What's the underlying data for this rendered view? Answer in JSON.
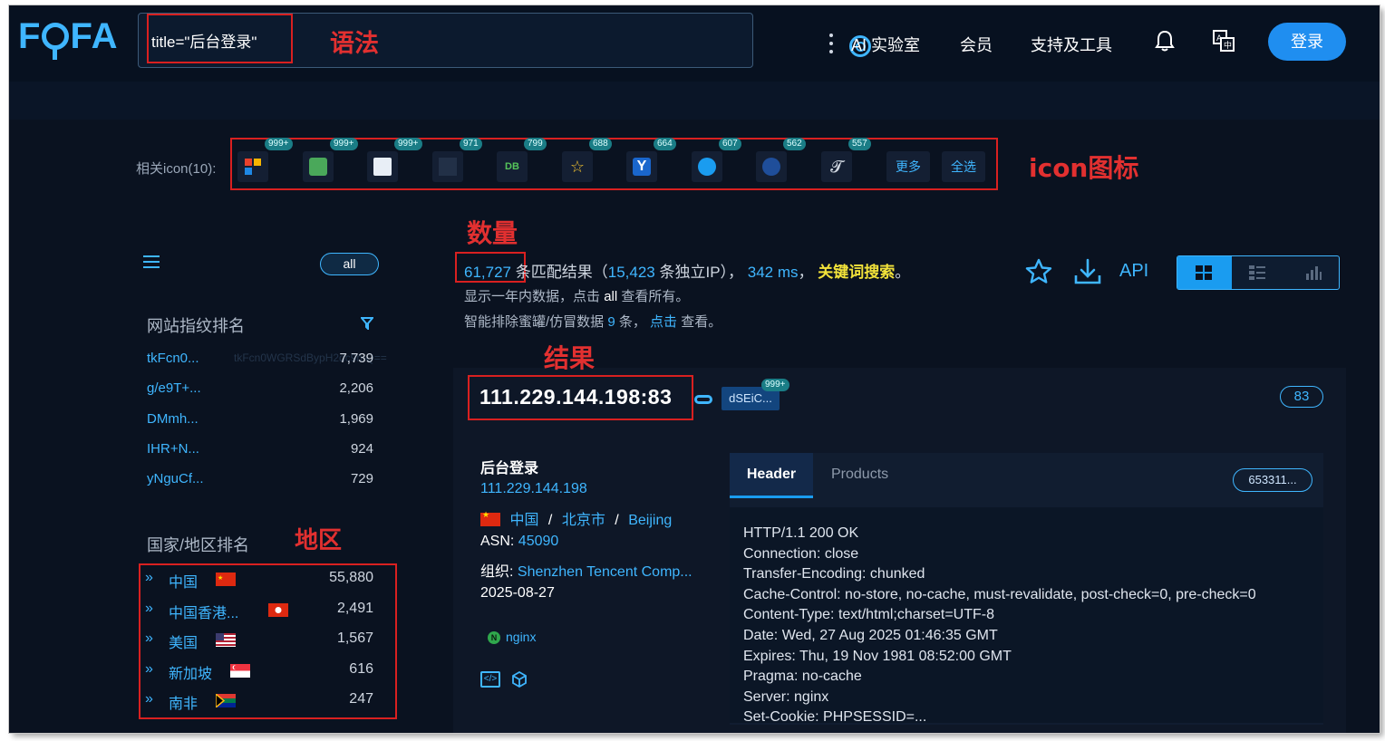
{
  "header": {
    "logo_text": "FOFA",
    "search_value": "title=\"后台登录\"",
    "nav": [
      "AI 实验室",
      "会员",
      "支持及工具"
    ],
    "login_label": "登录"
  },
  "icons": {
    "label": "相关icon(10):",
    "items": [
      {
        "badge": "999+",
        "glyph": "",
        "name": "windows-logo-icon"
      },
      {
        "badge": "999+",
        "glyph": "",
        "name": "green-leaf-icon"
      },
      {
        "badge": "999+",
        "glyph": "",
        "name": "document-icon"
      },
      {
        "badge": "971",
        "glyph": "",
        "name": "dark-app-icon"
      },
      {
        "badge": "799",
        "glyph": "DB",
        "name": "db-icon"
      },
      {
        "badge": "688",
        "glyph": "☆",
        "name": "star-app-icon"
      },
      {
        "badge": "664",
        "glyph": "Y",
        "name": "yellow-app-icon"
      },
      {
        "badge": "607",
        "glyph": "",
        "name": "chat-bubble-icon"
      },
      {
        "badge": "562",
        "glyph": "",
        "name": "globe-icon"
      },
      {
        "badge": "557",
        "glyph": "𝓣",
        "name": "script-t-icon"
      }
    ],
    "more_label": "更多",
    "select_all_label": "全选"
  },
  "annotations": {
    "syntax": "语法",
    "icon": "icon图标",
    "count": "数量",
    "result": "结果",
    "region": "地区"
  },
  "sidebar": {
    "all_label": "all",
    "fingerprint_title": "网站指纹排名",
    "fingerprints": [
      {
        "name": "tkFcn0...",
        "count": "7,739"
      },
      {
        "name": "g/e9T+...",
        "count": "2,206"
      },
      {
        "name": "DMmh...",
        "count": "1,969"
      },
      {
        "name": "IHR+N...",
        "count": "924"
      },
      {
        "name": "yNguCf...",
        "count": "729"
      }
    ],
    "fingerprint_ghost": "tkFcn0WGRSdBypH2dc9nIQ==",
    "country_title": "国家/地区排名",
    "countries": [
      {
        "name": "中国",
        "count": "55,880",
        "flag": "cn"
      },
      {
        "name": "中国香港...",
        "count": "2,491",
        "flag": "hk"
      },
      {
        "name": "美国",
        "count": "1,567",
        "flag": "us"
      },
      {
        "name": "新加坡",
        "count": "616",
        "flag": "sg"
      },
      {
        "name": "南非",
        "count": "247",
        "flag": "za"
      }
    ]
  },
  "stats": {
    "total": "61,727",
    "text_match": "条匹配结果（",
    "unique_ip": "15,423",
    "text_ip": "条独立IP），",
    "time": "342 ms",
    "text_comma": "，",
    "keyword": "关键词搜索",
    "text_end": "。",
    "line2_a": "显示一年内数据，点击",
    "line2_all": "all",
    "line2_b": "查看所有。",
    "line3_a": "智能排除蜜罐/仿冒数据",
    "line3_num": "9",
    "line3_b": "条，",
    "line3_click": "点击",
    "line3_c": "查看。",
    "api_label": "API"
  },
  "result": {
    "host": "111.229.144.198:83",
    "cert_chip": "dSEiC...",
    "cert_badge": "999+",
    "port": "83",
    "title": "后台登录",
    "ip": "111.229.144.198",
    "country": "中国",
    "sep": "/",
    "city": "北京市",
    "city_en": "Beijing",
    "asn_label": "ASN:",
    "asn": "45090",
    "org_label": "组织:",
    "org": "Shenzhen Tencent Comp...",
    "date": "2025-08-27",
    "server_tag": "nginx",
    "tab_header": "Header",
    "tab_products": "Products",
    "hash": "653311...",
    "header_lines": [
      "HTTP/1.1 200 OK",
      "Connection: close",
      "Transfer-Encoding: chunked",
      "Cache-Control: no-store, no-cache, must-revalidate, post-check=0, pre-check=0",
      "Content-Type: text/html;charset=UTF-8",
      "Date: Wed, 27 Aug 2025 01:46:35 GMT",
      "Expires: Thu, 19 Nov 1981 08:52:00 GMT",
      "Pragma: no-cache",
      "Server: nginx",
      "Set-Cookie: PHPSESSID=..."
    ]
  },
  "colors": {
    "accent": "#3fb6ff",
    "annotation": "#e23030",
    "keyword": "#f2e23a",
    "background": "#0a1220"
  }
}
